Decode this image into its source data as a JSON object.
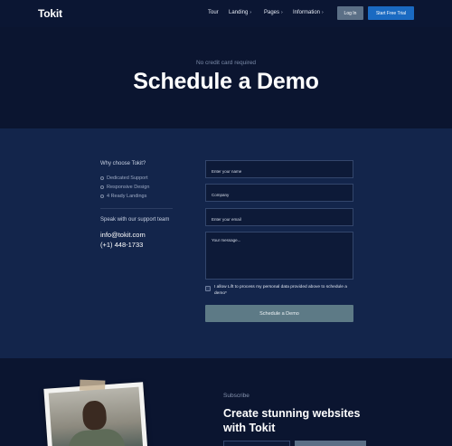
{
  "nav": {
    "logo": "Tokit",
    "items": [
      {
        "label": "Tour",
        "chevron": ""
      },
      {
        "label": "Landing",
        "chevron": "›"
      },
      {
        "label": "Pages",
        "chevron": "›"
      },
      {
        "label": "Information",
        "chevron": "›"
      }
    ],
    "login_label": "Log In",
    "trial_label": "Start Free Trial"
  },
  "hero": {
    "subtitle": "No credit card required",
    "title": "Schedule a Demo"
  },
  "info": {
    "why_heading": "Why choose Tokit?",
    "features": [
      "Dedicated Support",
      "Responsive Design",
      "4 Ready Landings"
    ],
    "support_heading": "Speak with our support team",
    "email": "info@tokit.com",
    "phone": "(+1) 448-1733"
  },
  "form": {
    "name_placeholder": "Enter your name",
    "company_placeholder": "Company",
    "email_placeholder": "Enter your email",
    "message_placeholder": "Your message...",
    "consent_text": "I allow Lift to process my personal data provided above to schedule a demo*",
    "submit_label": "Schedule a Demo"
  },
  "subscribe": {
    "label": "Subscribe",
    "title": "Create stunning websites with Tokit"
  },
  "colors": {
    "background": "#0b1530",
    "form_section": "#13254b",
    "accent": "#1a6ac2",
    "submit": "#5d7a86"
  }
}
